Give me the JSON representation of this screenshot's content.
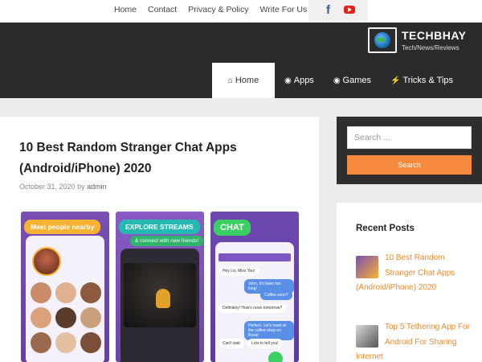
{
  "top_nav": {
    "links": [
      "Home",
      "Contact",
      "Privacy & Policy",
      "Write For Us"
    ]
  },
  "social": {
    "icons": [
      "facebook-icon",
      "youtube-icon"
    ],
    "facebook_color": "#3b5998",
    "youtube_color": "#e62117",
    "facebook_glyph": "f"
  },
  "brand": {
    "name": "TECHBHAY",
    "tagline": "Tech/News/Reviews"
  },
  "main_nav": {
    "items": [
      {
        "label": "Home",
        "icon": "home-icon",
        "active": true
      },
      {
        "label": "Apps",
        "icon": "android-icon",
        "active": false
      },
      {
        "label": "Games",
        "icon": "gamepad-icon",
        "active": false
      },
      {
        "label": "Tricks & Tips",
        "icon": "bolt-icon",
        "active": false
      }
    ]
  },
  "article": {
    "title": "10 Best Random Stranger Chat Apps (Android/iPhone) 2020",
    "date": "October 31, 2020",
    "by": "by",
    "author": "admin",
    "image_panels": [
      {
        "heading": "Meet people nearby"
      },
      {
        "heading": "EXPLORE STREAMS",
        "subheading": "& connect with new friends!"
      },
      {
        "heading": "CHAT",
        "bubbles": [
          "Hey Liv, Miss You!",
          "John, it's been too long!",
          "Coffee soon?",
          "Definitely! How's noon tomorrow?",
          "Perfect. Let's meet at the coffee shop on Rossi",
          "Can't wait",
          "Lots to tell you!"
        ]
      }
    ]
  },
  "sidebar": {
    "search": {
      "placeholder": "Search ...",
      "button": "Search"
    },
    "recent_posts": {
      "title": "Recent Posts",
      "posts": [
        {
          "title": "10 Best Random Stranger Chat Apps (Android/iPhone) 2020"
        },
        {
          "title": "Top 5 Tethering App For Android For Sharing Internet"
        }
      ]
    }
  },
  "colors": {
    "accent": "#f58a3c",
    "header_bg": "#2b2b2b",
    "link": "#f18a2a"
  }
}
